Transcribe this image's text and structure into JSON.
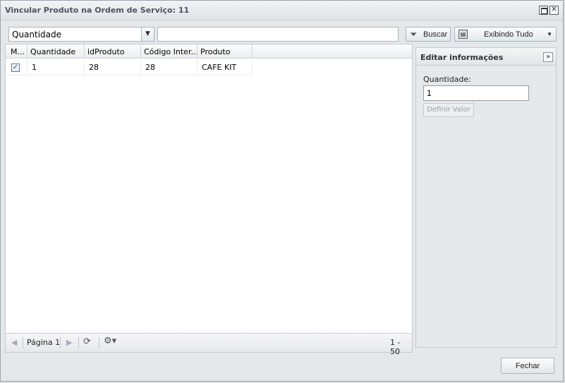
{
  "window": {
    "title": "Vincular Produto na Ordem de Serviço: 11",
    "maximize_symbol": "",
    "close_symbol": "✕"
  },
  "toolbar": {
    "field_select_value": "Quantidade",
    "search_value": "",
    "search_button_label": "Buscar",
    "view_button_label": "Exibindo Tudo"
  },
  "grid": {
    "columns": [
      "M...",
      "Quantidade",
      "idProduto",
      "Código Inter...",
      "Produto"
    ],
    "rows": [
      {
        "checked": "✓",
        "quantidade": "1",
        "idProduto": "28",
        "codigo": "28",
        "produto": "CAFE KIT"
      }
    ],
    "pagination": {
      "page_label": "Página 1",
      "range": "1 - 50"
    }
  },
  "side_panel": {
    "title": "Editar informações",
    "collapse_symbol": "»",
    "field_label": "Quantidade:",
    "field_value": "1",
    "set_button_label": "Definir Valor"
  },
  "footer": {
    "close_button_label": "Fechar"
  },
  "icons": {
    "filter": "filter-icon",
    "view": "view-icon",
    "refresh": "refresh-icon",
    "settings": "gear-icon"
  }
}
